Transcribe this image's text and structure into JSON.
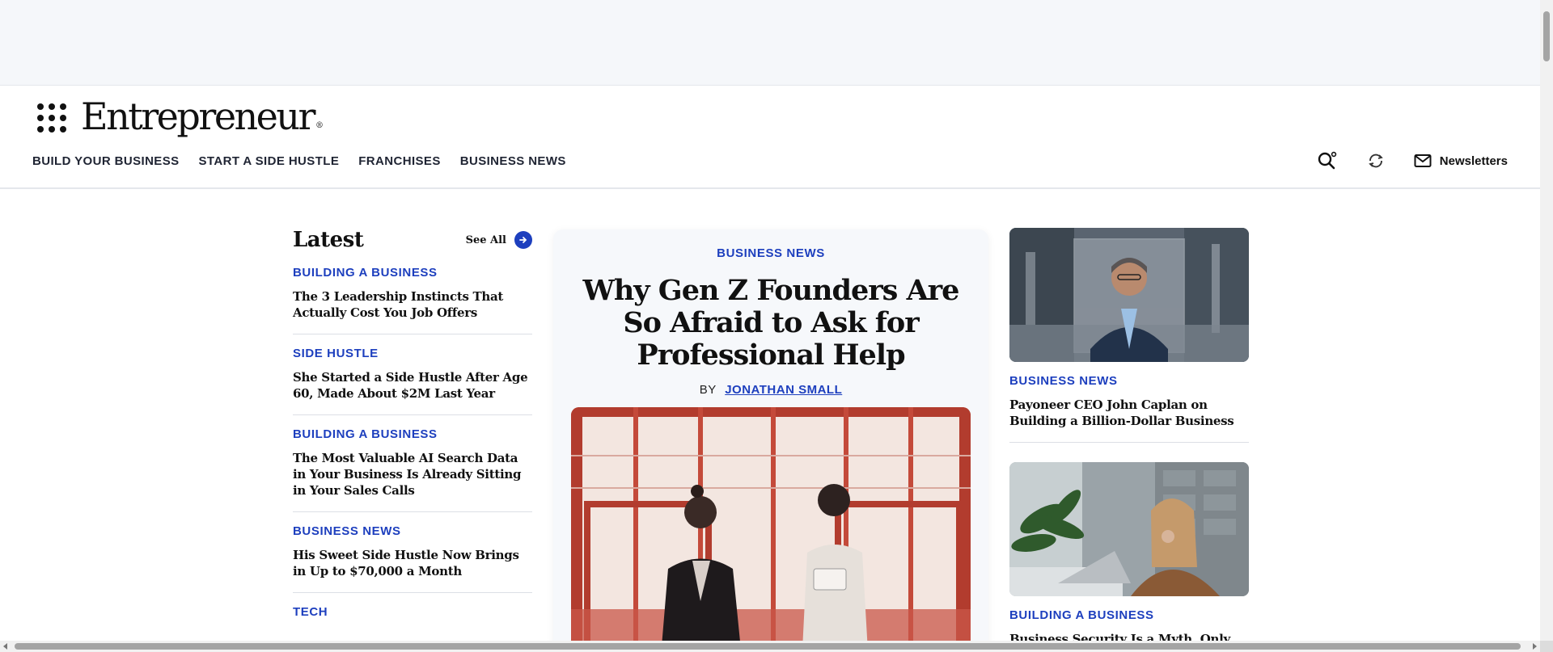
{
  "header": {
    "logo_text": "Entrepreneur",
    "logo_mark": "®",
    "nav": [
      "BUILD YOUR BUSINESS",
      "START A SIDE HUSTLE",
      "FRANCHISES",
      "BUSINESS NEWS"
    ],
    "newsletters_label": "Newsletters",
    "icons": [
      "menu-grid-icon",
      "search-icon",
      "refresh-icon",
      "mail-icon"
    ]
  },
  "latest": {
    "title": "Latest",
    "see_all": "See All",
    "items": [
      {
        "category": "BUILDING A BUSINESS",
        "headline": "The 3 Leadership Instincts That Actually Cost You Job Offers"
      },
      {
        "category": "SIDE HUSTLE",
        "headline": "She Started a Side Hustle After Age 60, Made About $2M Last Year"
      },
      {
        "category": "BUILDING A BUSINESS",
        "headline": "The Most Valuable AI Search Data in Your Business Is Already Sitting in Your Sales Calls"
      },
      {
        "category": "BUSINESS NEWS",
        "headline": "His Sweet Side Hustle Now Brings in Up to $70,000 a Month"
      },
      {
        "category": "TECH",
        "headline": ""
      }
    ]
  },
  "feature": {
    "category": "BUSINESS NEWS",
    "headline": "Why Gen Z Founders Are So Afraid to Ask for Professional Help",
    "by_label": "BY",
    "author": "JONATHAN SMALL"
  },
  "right": {
    "items": [
      {
        "category": "BUSINESS NEWS",
        "headline": "Payoneer CEO John Caplan on Building a Billion-Dollar Business"
      },
      {
        "category": "BUILDING A BUSINESS",
        "headline": "Business Security Is a Myth. Only the"
      }
    ]
  },
  "colors": {
    "accent": "#1d3fbe",
    "ad_background": "#f5f7fa",
    "feature_card": "#f6f8fb"
  }
}
